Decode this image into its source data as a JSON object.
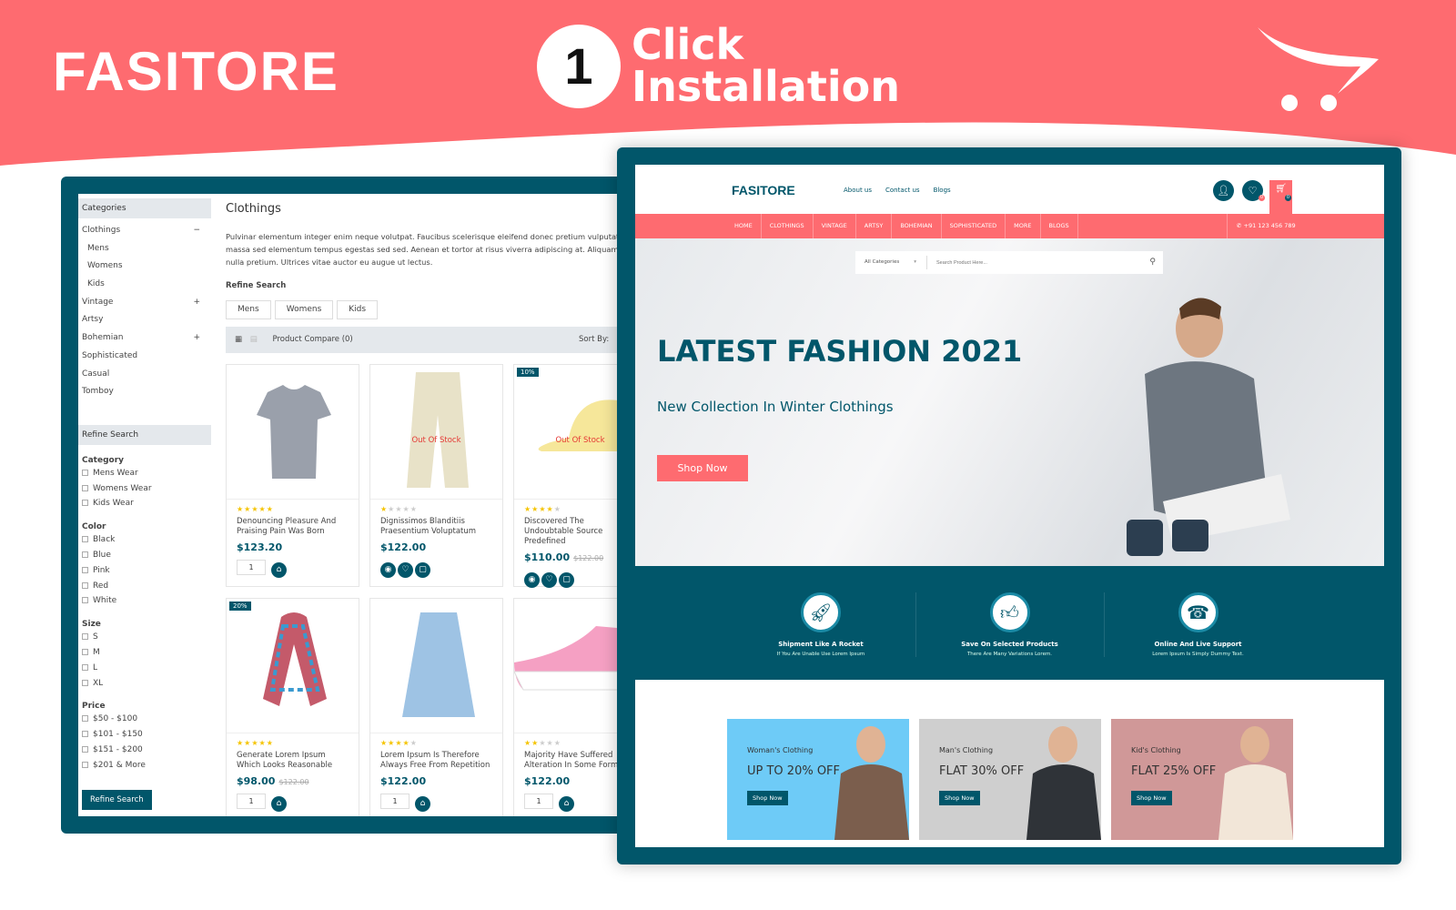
{
  "banner": {
    "brand": "FASITORE",
    "step_number": "1",
    "headline_line1": "Click",
    "headline_line2": "Installation"
  },
  "colors": {
    "accent": "#fe6b70",
    "primary": "#01566a",
    "star": "#f5c400"
  },
  "category_page": {
    "sidebar": {
      "categories_title": "Categories",
      "categories": [
        {
          "label": "Clothings",
          "toggle": "−",
          "children": [
            "Mens",
            "Womens",
            "Kids"
          ]
        },
        {
          "label": "Vintage",
          "toggle": "+"
        },
        {
          "label": "Artsy"
        },
        {
          "label": "Bohemian",
          "toggle": "+"
        },
        {
          "label": "Sophisticated"
        },
        {
          "label": "Casual"
        },
        {
          "label": "Tomboy"
        }
      ],
      "refine_title": "Refine Search",
      "filters": [
        {
          "title": "Category",
          "options": [
            "Mens Wear",
            "Womens Wear",
            "Kids Wear"
          ]
        },
        {
          "title": "Color",
          "options": [
            "Black",
            "Blue",
            "Pink",
            "Red",
            "White"
          ]
        },
        {
          "title": "Size",
          "options": [
            "S",
            "M",
            "L",
            "XL"
          ]
        },
        {
          "title": "Price",
          "options": [
            "$50 - $100",
            "$101 - $150",
            "$151 - $200",
            "$201 & More"
          ]
        }
      ],
      "refine_button": "Refine Search"
    },
    "title": "Clothings",
    "description": "Pulvinar elementum integer enim neque volutpat. Faucibus scelerisque eleifend donec pretium vulputate massa sed elementum tempus egestas sed sed. Aenean et tortor at risus viverra adipiscing at. Aliquam nulla pretium. Ultrices vitae auctor eu augue ut lectus.",
    "refine_label": "Refine Search",
    "refine_buttons": [
      "Mens",
      "Womens",
      "Kids"
    ],
    "toolbar": {
      "compare": "Product Compare (0)",
      "sort_label": "Sort By:"
    },
    "products": [
      {
        "name": "Denouncing Pleasure And Praising Pain Was Born",
        "price": "$123.20",
        "old_price": "",
        "rating": 5,
        "qty": "1",
        "badge": "",
        "stock": "",
        "icon": "tshirt"
      },
      {
        "name": "Dignissimos Blanditiis Praesentium Voluptatum",
        "price": "$122.00",
        "old_price": "",
        "rating": 1,
        "qty": "",
        "badge": "",
        "stock": "Out Of Stock",
        "icon": "pants"
      },
      {
        "name": "Discovered The Undoubtable Source Predefined",
        "price": "$110.00",
        "old_price": "$122.00",
        "rating": 4,
        "qty": "",
        "badge": "10%",
        "stock": "Out Of Stock",
        "icon": "cap"
      },
      {
        "name": "Generate Lorem Ipsum Which Looks Reasonable",
        "price": "$98.00",
        "old_price": "$122.00",
        "rating": 5,
        "qty": "1",
        "badge": "20%",
        "stock": "",
        "icon": "scarf"
      },
      {
        "name": "Lorem Ipsum Is Therefore Always Free From Repetition",
        "price": "$122.00",
        "old_price": "",
        "rating": 4,
        "qty": "1",
        "badge": "",
        "stock": "",
        "icon": "skirt"
      },
      {
        "name": "Majority Have Suffered Alteration In Some Form",
        "price": "$122.00",
        "old_price": "",
        "rating": 2,
        "qty": "1",
        "badge": "",
        "stock": "",
        "icon": "sneaker"
      }
    ]
  },
  "home_page": {
    "logo": "FASITORE",
    "top_links": [
      "About us",
      "Contact us",
      "Blogs"
    ],
    "wishlist_count": "0",
    "cart_count": "0",
    "nav": [
      "HOME",
      "CLOTHINGS",
      "VINTAGE",
      "ARTSY",
      "BOHEMIAN",
      "SOPHISTICATED",
      "MORE",
      "BLOGS"
    ],
    "phone": "+91 123 456 789",
    "search": {
      "category": "All Categories",
      "placeholder": "Search Product Here..."
    },
    "hero": {
      "title": "LATEST FASHION 2021",
      "subtitle": "New Collection In Winter Clothings",
      "button": "Shop Now"
    },
    "features": [
      {
        "icon": "rocket",
        "title": "Shipment Like A Rocket",
        "text": "If You Are Unable Use Lorem Ipsum"
      },
      {
        "icon": "thumbs-up",
        "title": "Save On Selected Products",
        "text": "There Are Many Variations Lorem."
      },
      {
        "icon": "telephone",
        "title": "Online And Live Support",
        "text": "Lorem Ipsum Is Simply Dummy Text."
      }
    ],
    "promos": [
      {
        "label": "Woman's Clothing",
        "offer": "UP TO 20% OFF",
        "button": "Shop Now",
        "bg": "#6ecbf7"
      },
      {
        "label": "Man's Clothing",
        "offer": "FLAT 30% OFF",
        "button": "Shop Now",
        "bg": "#cfcfcf"
      },
      {
        "label": "Kid's Clothing",
        "offer": "FLAT 25% OFF",
        "button": "Shop Now",
        "bg": "#d09898"
      }
    ]
  }
}
